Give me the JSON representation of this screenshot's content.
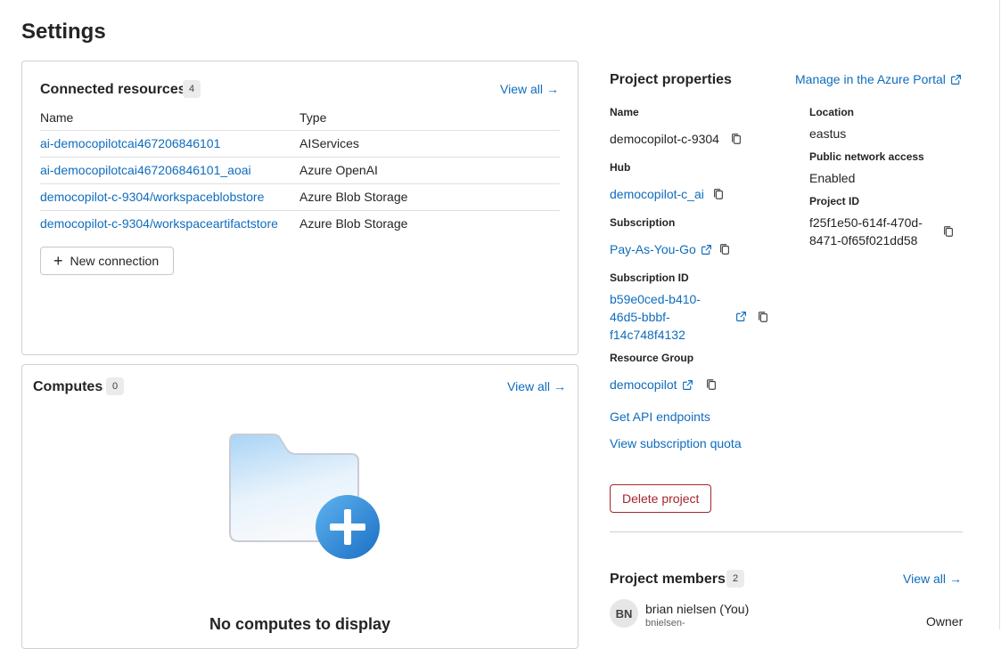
{
  "page": {
    "title": "Settings"
  },
  "connected_resources": {
    "title": "Connected resources",
    "count": "4",
    "view_all": "View all",
    "columns": {
      "name": "Name",
      "type": "Type"
    },
    "rows": [
      {
        "name": "ai-democopilotcai467206846101",
        "type": "AIServices"
      },
      {
        "name": "ai-democopilotcai467206846101_aoai",
        "type": "Azure OpenAI"
      },
      {
        "name": "democopilot-c-9304/workspaceblobstore",
        "type": "Azure Blob Storage"
      },
      {
        "name": "democopilot-c-9304/workspaceartifactstore",
        "type": "Azure Blob Storage"
      }
    ],
    "new_connection": "New connection"
  },
  "computes": {
    "title": "Computes",
    "count": "0",
    "view_all": "View all",
    "empty_message": "No computes to display"
  },
  "project_properties": {
    "title": "Project properties",
    "manage_link": "Manage in the Azure Portal",
    "name_label": "Name",
    "name_value": "democopilot-c-9304",
    "hub_label": "Hub",
    "hub_value": "democopilot-c_ai",
    "subscription_label": "Subscription",
    "subscription_value": "Pay-As-You-Go",
    "subscription_id_label": "Subscription ID",
    "subscription_id_lines": [
      "b59e0ced-b410-",
      "46d5-bbbf-",
      "f14c748f4132"
    ],
    "resource_group_label": "Resource Group",
    "resource_group_value": "democopilot",
    "location_label": "Location",
    "location_value": "eastus",
    "public_network_label": "Public network access",
    "public_network_value": "Enabled",
    "project_id_label": "Project ID",
    "project_id_lines": [
      "f25f1e50-614f-470d-",
      "8471-0f65f021dd58"
    ],
    "api_endpoints": "Get API endpoints",
    "subscription_quota": "View subscription quota",
    "delete_button": "Delete project"
  },
  "project_members": {
    "title": "Project members",
    "count": "2",
    "view_all": "View all",
    "members": [
      {
        "initials": "BN",
        "name": "brian nielsen (You)",
        "subtext": "bnielsen-",
        "role": "Owner"
      }
    ]
  },
  "colors": {
    "link": "#0f6cbd",
    "danger": "#a4262c",
    "border": "#d1d1d1",
    "text": "#242424"
  },
  "icons": [
    "arrow-right-icon",
    "copy-icon",
    "open-external-icon",
    "add-icon",
    "folder-add-illustration"
  ]
}
